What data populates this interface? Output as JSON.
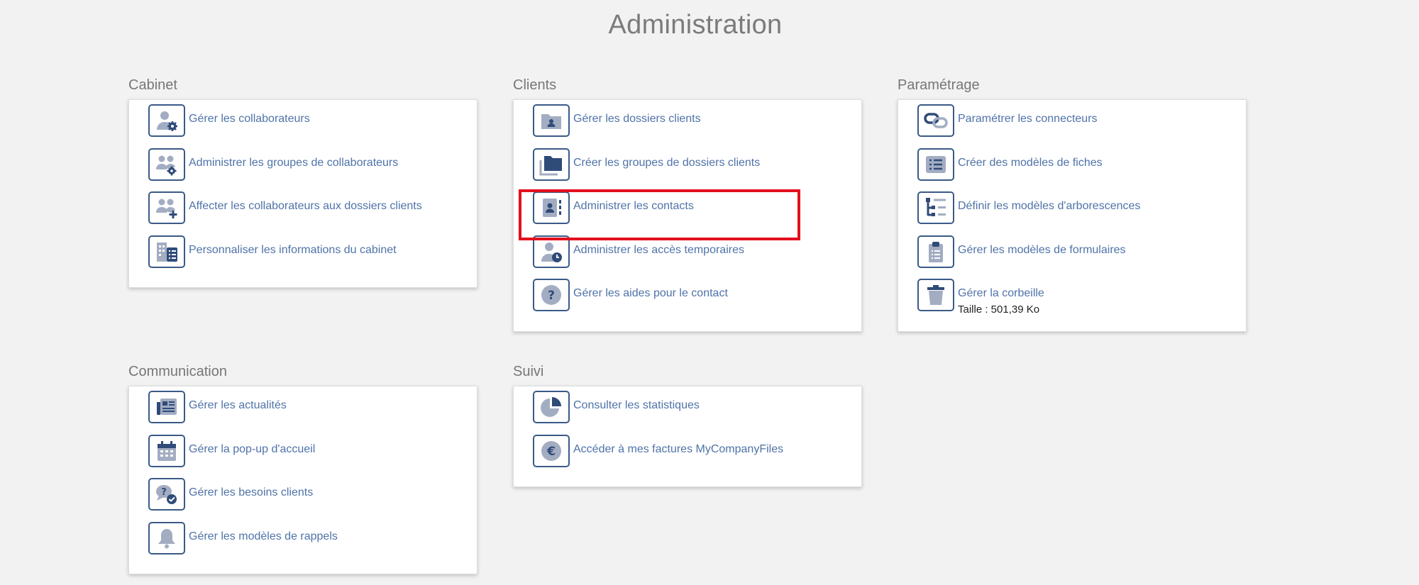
{
  "page": {
    "title": "Administration"
  },
  "sections": {
    "cabinet": {
      "title": "Cabinet",
      "items": [
        {
          "label": "Gérer les collaborateurs",
          "icon": "user-gear-icon"
        },
        {
          "label": "Administrer les groupes de collaborateurs",
          "icon": "users-gear-icon"
        },
        {
          "label": "Affecter les collaborateurs aux dossiers clients",
          "icon": "users-plus-icon"
        },
        {
          "label": "Personnaliser les informations du cabinet",
          "icon": "building-list-icon"
        }
      ]
    },
    "clients": {
      "title": "Clients",
      "items": [
        {
          "label": "Gérer les dossiers clients",
          "icon": "folder-user-icon"
        },
        {
          "label": "Créer les groupes de dossiers clients",
          "icon": "folders-icon"
        },
        {
          "label": "Administrer les contacts",
          "icon": "contact-card-icon",
          "highlighted": true
        },
        {
          "label": "Administrer les accès temporaires",
          "icon": "user-clock-icon"
        },
        {
          "label": "Gérer les aides pour le contact",
          "icon": "question-circle-icon"
        }
      ]
    },
    "parametrage": {
      "title": "Paramétrage",
      "items": [
        {
          "label": "Paramétrer les connecteurs",
          "icon": "link-icon"
        },
        {
          "label": "Créer des modèles de fiches",
          "icon": "list-card-icon"
        },
        {
          "label": "Définir les modèles d'arborescences",
          "icon": "tree-list-icon"
        },
        {
          "label": "Gérer les modèles de formulaires",
          "icon": "clipboard-icon"
        },
        {
          "label": "Gérer la corbeille",
          "sub": "Taille : 501,39 Ko",
          "icon": "trash-icon"
        }
      ]
    },
    "communication": {
      "title": "Communication",
      "items": [
        {
          "label": "Gérer les actualités",
          "icon": "newspaper-icon"
        },
        {
          "label": "Gérer la pop-up d'accueil",
          "icon": "calendar-icon"
        },
        {
          "label": "Gérer les besoins clients",
          "icon": "question-bubble-icon"
        },
        {
          "label": "Gérer les modèles de rappels",
          "icon": "bell-icon"
        }
      ]
    },
    "suivi": {
      "title": "Suivi",
      "items": [
        {
          "label": "Consulter les statistiques",
          "icon": "pie-chart-icon"
        },
        {
          "label": "Accéder à mes factures MyCompanyFiles",
          "icon": "euro-icon"
        }
      ]
    }
  },
  "colors": {
    "icon_dark": "#2f4b78",
    "icon_light": "#a3adc2",
    "link": "#4f73a8",
    "highlight": "#e3101e"
  }
}
